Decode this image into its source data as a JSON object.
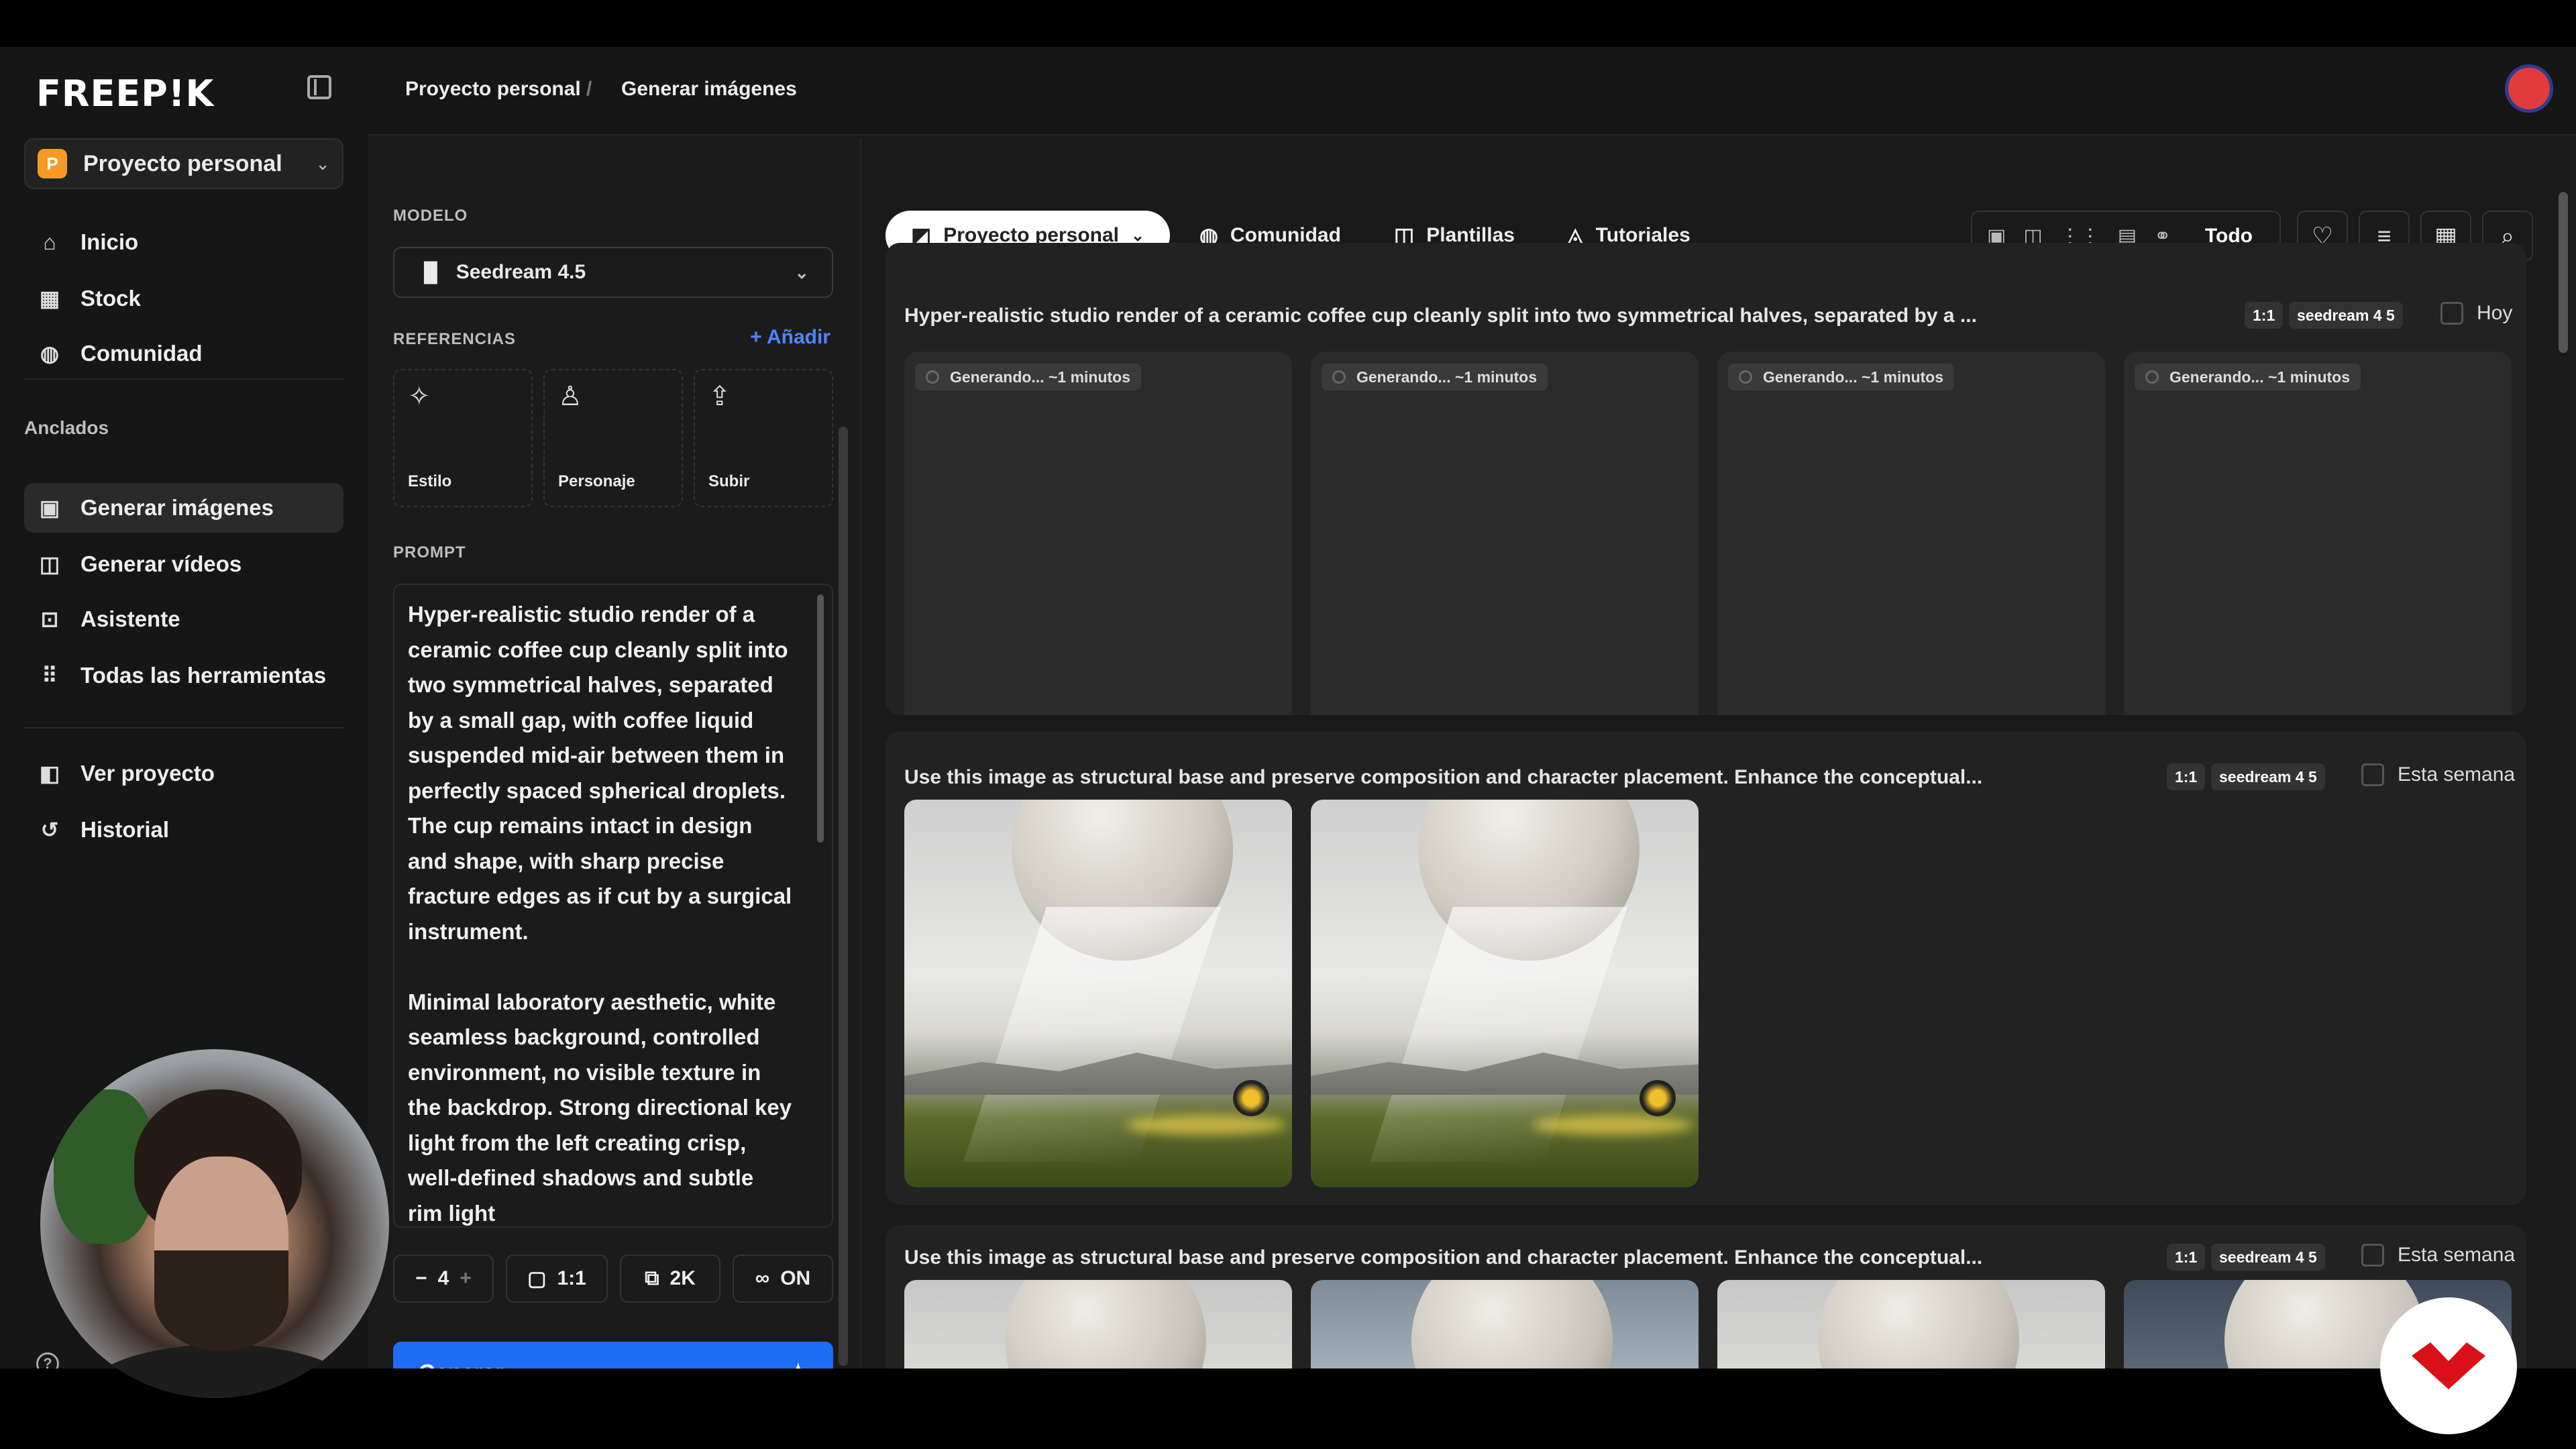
{
  "sidebar": {
    "logo": "FREEP!K",
    "project": {
      "badge": "P",
      "name": "Proyecto personal"
    },
    "nav_top": [
      {
        "label": "Inicio",
        "icon": "⌂"
      },
      {
        "label": "Stock",
        "icon": "▦"
      },
      {
        "label": "Comunidad",
        "icon": "◍"
      }
    ],
    "pinned_label": "Anclados",
    "nav_pinned": [
      {
        "label": "Generar imágenes",
        "icon": "▣"
      },
      {
        "label": "Generar vídeos",
        "icon": "◫"
      },
      {
        "label": "Asistente",
        "icon": "⊡"
      },
      {
        "label": "Todas las herramientas",
        "icon": "⠿"
      }
    ],
    "nav_bottom": [
      {
        "label": "Ver proyecto",
        "icon": "◧"
      },
      {
        "label": "Historial",
        "icon": "↺"
      }
    ],
    "help": "?"
  },
  "breadcrumb": {
    "project": "Proyecto personal",
    "sep": "/",
    "page": "Generar imágenes"
  },
  "panel": {
    "model_label": "MODELO",
    "model_value": "Seedream 4.5",
    "model_icon": "bar-chart-icon",
    "refs_label": "REFERENCIAS",
    "refs_add": "+ Añadir",
    "refs": [
      {
        "label": "Estilo",
        "icon": "✧"
      },
      {
        "label": "Personaje",
        "icon": "♙"
      },
      {
        "label": "Subir",
        "icon": "⇪"
      }
    ],
    "prompt_label": "PROMPT",
    "prompt_text": "Hyper-realistic studio render of a ceramic coffee cup cleanly split into two symmetrical halves, separated by a small gap, with coffee liquid suspended mid-air between them in perfectly spaced spherical droplets. The cup remains intact in design and shape, with sharp precise fracture edges as if cut by a surgical instrument.\n\nMinimal laboratory aesthetic, white seamless background, controlled environment, no visible texture in the backdrop. Strong directional key light from the left creating crisp, well-defined shadows and subtle rim light",
    "options": {
      "count_minus": "−",
      "count": "4",
      "count_plus": "+",
      "ratio": "1:1",
      "resolution": "2K",
      "mode": "ON"
    },
    "generate_label": "Generar"
  },
  "main": {
    "tabs": [
      {
        "label": "Proyecto personal",
        "icon": "◩"
      },
      {
        "label": "Comunidad",
        "icon": "◍"
      },
      {
        "label": "Plantillas",
        "icon": "◫"
      },
      {
        "label": "Tutoriales",
        "icon": "◬"
      }
    ],
    "filter_all": "Todo",
    "groups": [
      {
        "title": "Hyper-realistic studio render of a ceramic coffee cup cleanly split into two symmetrical halves, separated by a ...",
        "ratio": "1:1",
        "model": "seedream 4 5",
        "when": "Hoy",
        "tiles": [
          {
            "status": "Generando... ~1 minutos",
            "progress": 0.08
          },
          {
            "status": "Generando... ~1 minutos",
            "progress": 0.08
          },
          {
            "status": "Generando... ~1 minutos",
            "progress": 0.08
          },
          {
            "status": "Generando... ~1 minutos",
            "progress": 0.08
          }
        ]
      },
      {
        "title": "Use this image as structural base and preserve composition and character placement. Enhance the conceptual...",
        "ratio": "1:1",
        "model": "seedream 4 5",
        "when": "Esta semana"
      },
      {
        "title": "Use this image as structural base and preserve composition and character placement. Enhance the conceptual...",
        "ratio": "1:1",
        "model": "seedream 4 5",
        "when": "Esta semana"
      }
    ]
  },
  "colors": {
    "accent": "#1f6cf5",
    "link": "#4f86ff",
    "badge": "#f59a23"
  }
}
